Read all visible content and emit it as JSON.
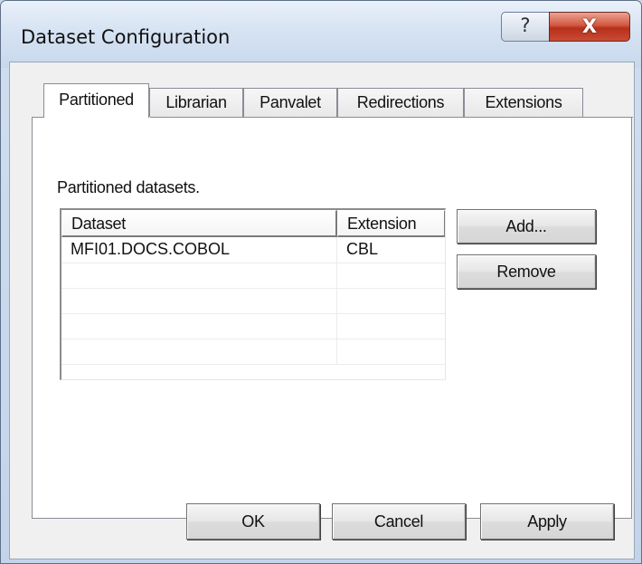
{
  "window": {
    "title": "Dataset Configuration",
    "help_glyph": "?",
    "close_glyph": "X"
  },
  "tabs": [
    {
      "label": "Partitioned",
      "active": true
    },
    {
      "label": "Librarian",
      "active": false
    },
    {
      "label": "Panvalet",
      "active": false
    },
    {
      "label": "Redirections",
      "active": false
    },
    {
      "label": "Extensions",
      "active": false
    }
  ],
  "partitioned": {
    "section_label": "Partitioned datasets.",
    "columns": [
      "Dataset",
      "Extension"
    ],
    "rows": [
      [
        "MFI01.DOCS.COBOL",
        "CBL"
      ],
      [
        "",
        ""
      ],
      [
        "",
        ""
      ],
      [
        "",
        ""
      ],
      [
        "",
        ""
      ]
    ],
    "add_label": "Add...",
    "remove_label": "Remove"
  },
  "footer": {
    "ok_label": "OK",
    "cancel_label": "Cancel",
    "apply_label": "Apply"
  },
  "colors": {
    "close_button": "#c94b34",
    "tab_border": "#898c95",
    "panel_bg": "#ffffff"
  }
}
